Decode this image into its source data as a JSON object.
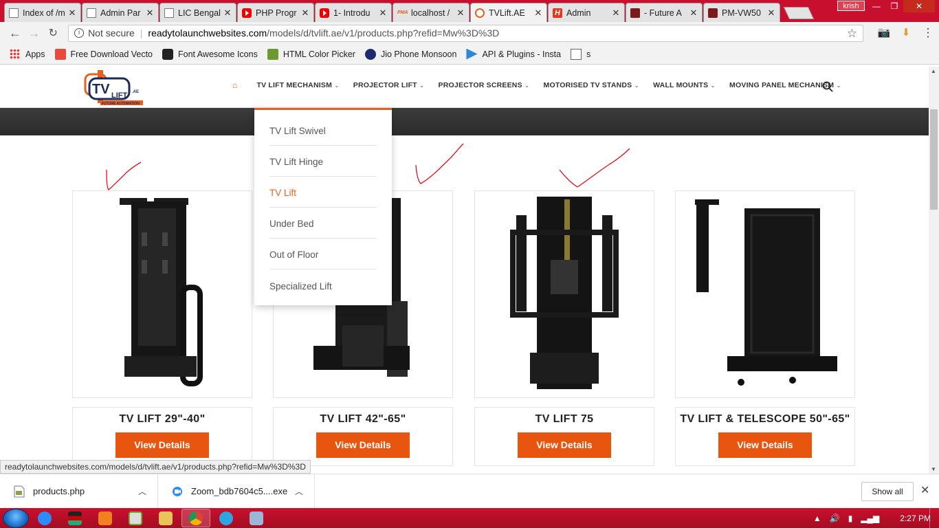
{
  "browser": {
    "tabs": [
      {
        "title": "Index of /m",
        "icon": "doc"
      },
      {
        "title": "Admin Par",
        "icon": "doc"
      },
      {
        "title": "LIC Bengal",
        "icon": "doc"
      },
      {
        "title": "PHP Progr",
        "icon": "yt"
      },
      {
        "title": "1- Introdu",
        "icon": "yt"
      },
      {
        "title": "localhost /",
        "icon": "pma"
      },
      {
        "title": "TVLift.AE",
        "icon": "tv"
      },
      {
        "title": "Admin",
        "icon": "h"
      },
      {
        "title": "- Future A",
        "icon": "fa"
      },
      {
        "title": "PM-VW50",
        "icon": "fa"
      }
    ],
    "profile_name": "krish",
    "security_label": "Not secure",
    "url_host": "readytolaunchwebsites.com",
    "url_path": "/models/d/tvlift.ae/v1/products.php?refid=Mw%3D%3D",
    "bookmarks": [
      {
        "label": "Apps",
        "icon": "apps-grid-icon"
      },
      {
        "label": "Free Download Vecto",
        "icon": "freepik-icon"
      },
      {
        "label": "Font Awesome Icons",
        "icon": "font-awesome-icon"
      },
      {
        "label": "HTML Color Picker",
        "icon": "w3schools-icon"
      },
      {
        "label": "Jio Phone Monsoon",
        "icon": "jio-icon"
      },
      {
        "label": "API & Plugins - Insta",
        "icon": "api-icon"
      },
      {
        "label": "s",
        "icon": "page-icon"
      }
    ]
  },
  "site": {
    "logo_tv": "TV",
    "logo_lift": "LIFT",
    "logo_ae": ".AE",
    "logo_tagline": "FUTURE AUTOMATION",
    "nav": [
      "TV LIFT MECHANISM",
      "PROJECTOR LIFT",
      "PROJECTOR SCREENS",
      "MOTORISED TV STANDS",
      "WALL MOUNTS",
      "MOVING PANEL MECHANISM"
    ],
    "dropdown": [
      "TV Lift Swivel",
      "TV Lift Hinge",
      "TV Lift",
      "Under Bed",
      "Out of Floor",
      "Specialized Lift"
    ],
    "dropdown_active": "TV Lift",
    "products": [
      {
        "title": "TV LIFT 29\"-40\"",
        "button": "View Details"
      },
      {
        "title": "TV LIFT 42\"-65\"",
        "button": "View Details"
      },
      {
        "title": "TV LIFT 75",
        "button": "View Details"
      },
      {
        "title": "TV LIFT & TELESCOPE 50\"-65\"",
        "button": "View Details"
      }
    ],
    "accent_color": "#e8550e"
  },
  "status_url": "readytolaunchwebsites.com/models/d/tvlift.ae/v1/products.php?refid=Mw%3D%3D",
  "downloads": [
    {
      "name": "products.php",
      "icon": "php-file-icon"
    },
    {
      "name": "Zoom_bdb7604c5....exe",
      "icon": "zoom-icon"
    }
  ],
  "show_all_label": "Show all",
  "taskbar": {
    "time": "2:27 PM"
  }
}
